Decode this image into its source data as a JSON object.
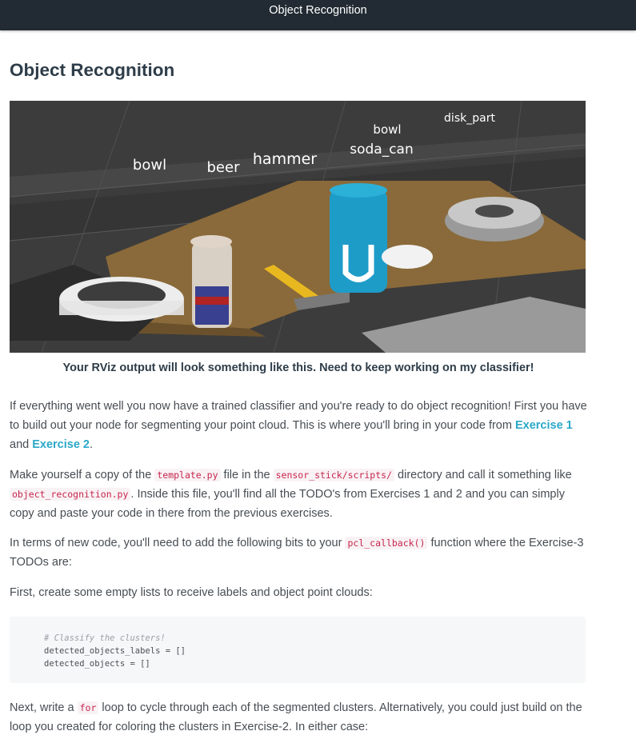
{
  "header": {
    "title": "Object Recognition"
  },
  "page_title": "Object Recognition",
  "figure": {
    "labels": [
      "disk_part",
      "bowl",
      "soda_can",
      "bowl",
      "beer",
      "hammer"
    ]
  },
  "caption": "Your RViz output will look something like this. Need to keep working on my classifier!",
  "para1": {
    "text": "If everything went well you now have a trained classifier and you're ready to do object recognition! First you have to build out your node for segmenting your point cloud. This is where you'll bring in your code from ",
    "link1": "Exercise 1",
    "and": " and ",
    "link2": "Exercise 2",
    "end": "."
  },
  "para2": {
    "t1": "Make yourself a copy of the ",
    "code1": "template.py",
    "t2": " file in the ",
    "code2": "sensor_stick/scripts/",
    "t3": " directory and call it something like ",
    "code3": "object_recognition.py",
    "t4": ". Inside this file, you'll find all the TODO's from Exercises 1 and 2 and you can simply copy and paste your code in there from the previous exercises."
  },
  "para3": {
    "t1": "In terms of new code, you'll need to add the following bits to your ",
    "code1": "pcl_callback()",
    "t2": " function where the Exercise-3 TODOs are:"
  },
  "para4": "First, create some empty lists to receive labels and object point clouds:",
  "code_block": {
    "line1": "# Classify the clusters!",
    "line2": "detected_objects_labels = []",
    "line3": "detected_objects = []"
  },
  "para5": {
    "t1": "Next, write a ",
    "code1": "for",
    "t2": " loop to cycle through each of the segmented clusters. Alternatively, you could just build on the loop you created for coloring the clusters in Exercise-2. In either case:"
  }
}
